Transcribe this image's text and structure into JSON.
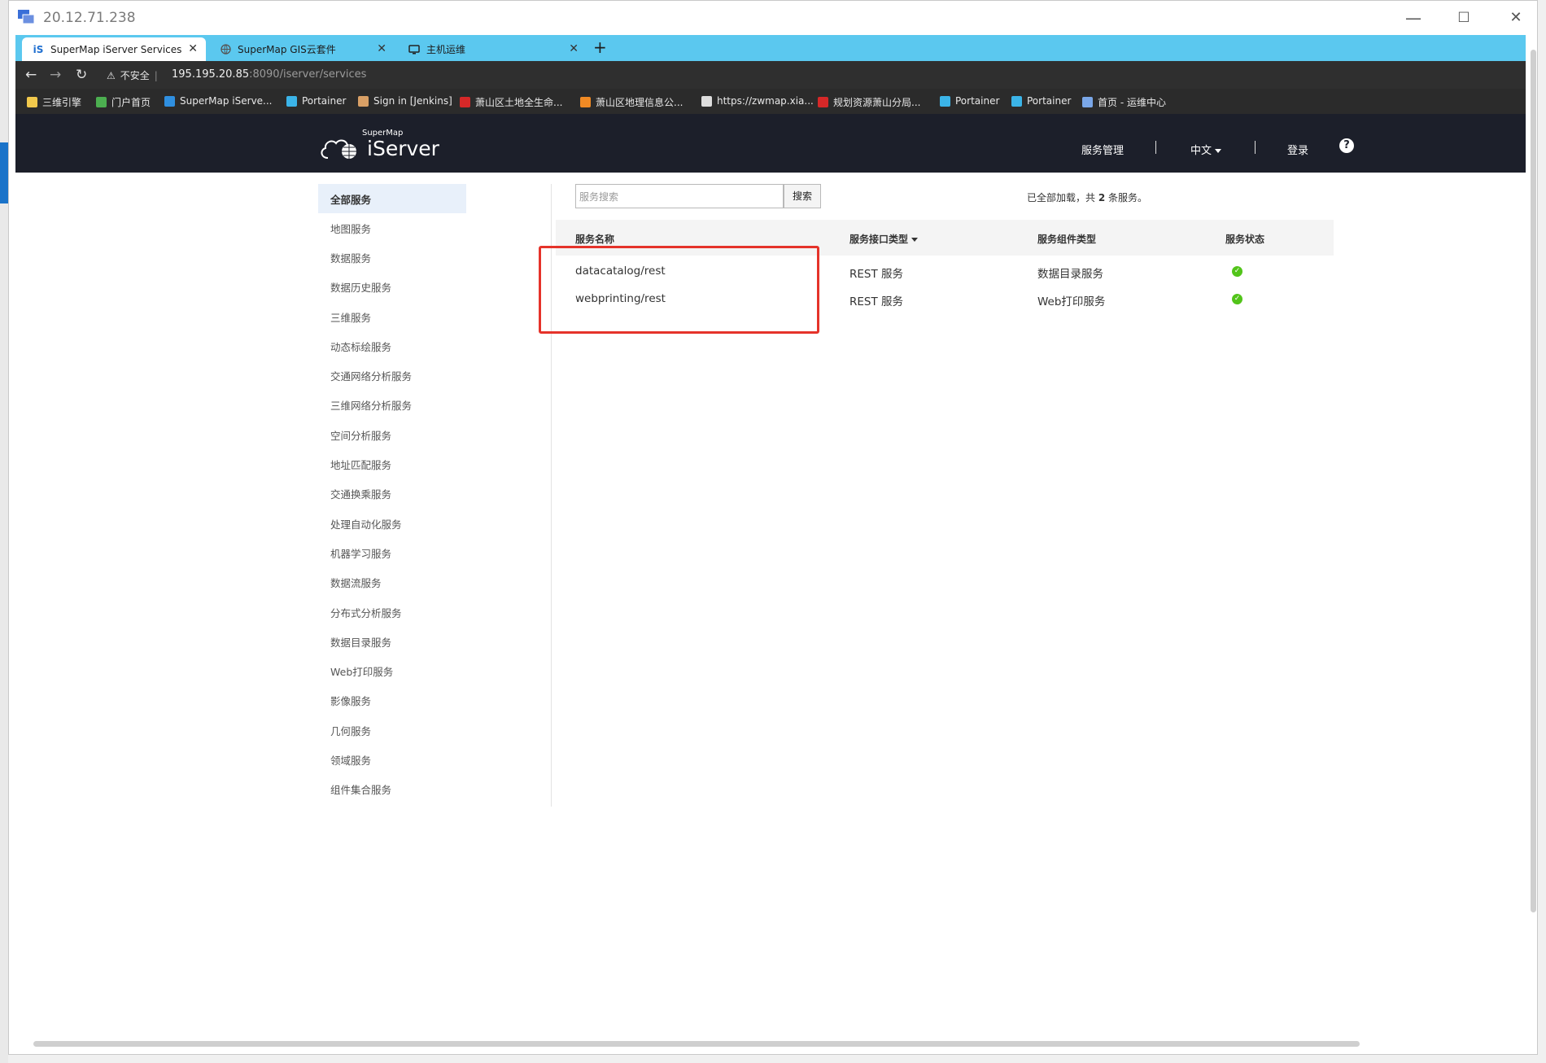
{
  "window": {
    "title": "20.12.71.238",
    "minimize": "—",
    "maximize": "☐",
    "close": "✕"
  },
  "tabs": [
    {
      "icon": "iS",
      "label": "SuperMap iServer Services",
      "close": "✕"
    },
    {
      "icon": "globe",
      "label": "SuperMap GIS云套件",
      "close": "✕"
    },
    {
      "icon": "monitor",
      "label": "主机运维",
      "close": "✕"
    }
  ],
  "new_tab": "+",
  "address": {
    "back": "←",
    "forward": "→",
    "reload": "↻",
    "warning_icon": "⚠",
    "insecure_label": "不安全",
    "url_host": "195.195.20.85",
    "url_rest": ":8090/iserver/services"
  },
  "bookmarks": [
    {
      "label": "三维引擎",
      "color": "#f2c94c"
    },
    {
      "label": "门户首页",
      "color": "#4caf50"
    },
    {
      "label": "SuperMap iServe...",
      "color": "#2f8fe0"
    },
    {
      "label": "Portainer",
      "color": "#3bb4e8"
    },
    {
      "label": "Sign in [Jenkins]",
      "color": "#d9a066"
    },
    {
      "label": "萧山区土地全生命...",
      "color": "#d62828"
    },
    {
      "label": "萧山区地理信息公...",
      "color": "#f08a24"
    },
    {
      "label": "https://zwmap.xia...",
      "color": "#dddddd"
    },
    {
      "label": "规划资源萧山分局...",
      "color": "#d62828"
    },
    {
      "label": "Portainer",
      "color": "#3bb4e8"
    },
    {
      "label": "Portainer",
      "color": "#3bb4e8"
    },
    {
      "label": "首页 - 运维中心",
      "color": "#7aa7e8"
    }
  ],
  "header": {
    "logo_small": "SuperMap",
    "logo_big": "iServer",
    "nav_service_mgmt": "服务管理",
    "nav_lang": "中文",
    "nav_login": "登录",
    "help": "?"
  },
  "sidebar": {
    "items": [
      "全部服务",
      "地图服务",
      "数据服务",
      "数据历史服务",
      "三维服务",
      "动态标绘服务",
      "交通网络分析服务",
      "三维网络分析服务",
      "空间分析服务",
      "地址匹配服务",
      "交通换乘服务",
      "处理自动化服务",
      "机器学习服务",
      "数据流服务",
      "分布式分析服务",
      "数据目录服务",
      "Web打印服务",
      "影像服务",
      "几何服务",
      "领域服务",
      "组件集合服务"
    ]
  },
  "search": {
    "placeholder": "服务搜索",
    "button": "搜索"
  },
  "loaded_status": {
    "prefix": "已全部加载，共 ",
    "count": "2",
    "suffix": " 条服务。"
  },
  "table": {
    "headers": [
      "服务名称",
      "服务接口类型",
      "服务组件类型",
      "服务状态"
    ],
    "rows": [
      {
        "name": "datacatalog/rest",
        "interface": "REST 服务",
        "component": "数据目录服务",
        "status": "✓"
      },
      {
        "name": "webprinting/rest",
        "interface": "REST 服务",
        "component": "Web打印服务",
        "status": "✓"
      }
    ]
  },
  "colors": {
    "tab_strip": "#5bc8ef",
    "header_bg": "#1c1f2a",
    "highlight_border": "#e5332a",
    "status_ok": "#52c41a"
  }
}
